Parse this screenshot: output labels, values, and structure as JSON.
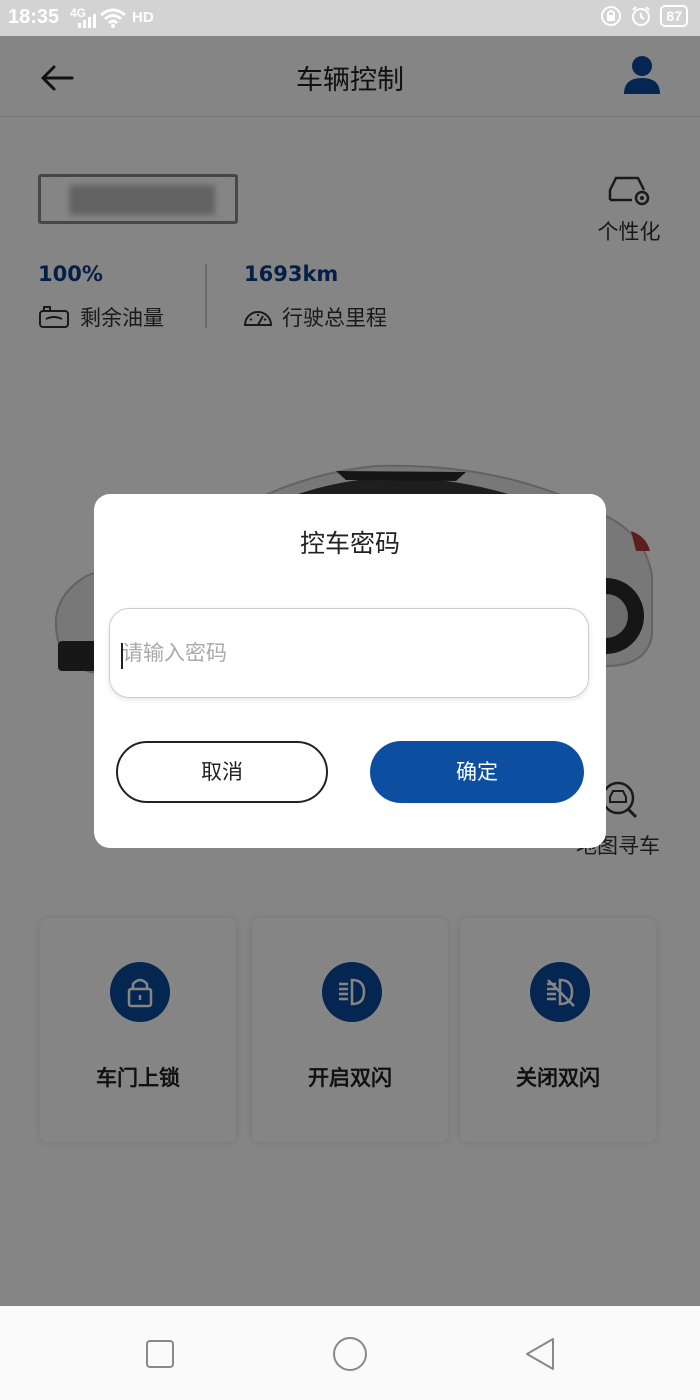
{
  "status_bar": {
    "time": "18:35",
    "network": "4G",
    "hd": "HD",
    "battery": "87"
  },
  "header": {
    "title": "车辆控制"
  },
  "vehicle": {
    "personalize_label": "个性化",
    "fuel_value": "100%",
    "fuel_label": "剩余油量",
    "mileage_value": "1693km",
    "mileage_label": "行驶总里程",
    "find_car_label": "地图寻车"
  },
  "controls": [
    {
      "label": "车门上锁",
      "icon": "lock-icon"
    },
    {
      "label": "开启双闪",
      "icon": "hazard-on-icon"
    },
    {
      "label": "关闭双闪",
      "icon": "hazard-off-icon"
    }
  ],
  "dialog": {
    "title": "控车密码",
    "password_placeholder": "请输入密码",
    "password_value": "",
    "cancel_label": "取消",
    "confirm_label": "确定"
  },
  "colors": {
    "primary": "#0c4fa0",
    "accent_text": "#0a3d86"
  }
}
